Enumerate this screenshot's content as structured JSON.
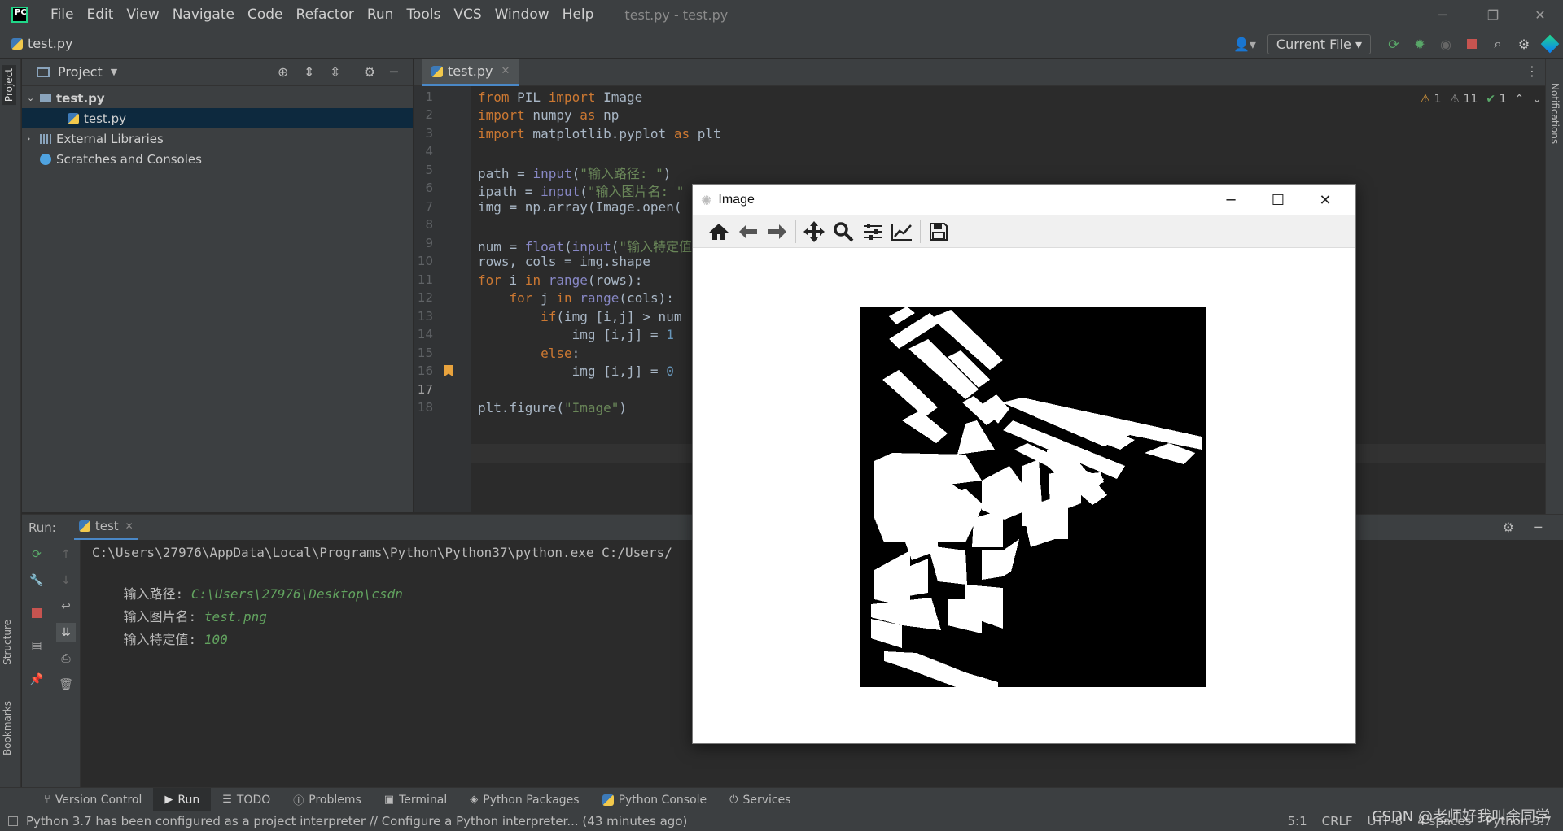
{
  "titlebar": {
    "logo": "PC",
    "menu": [
      "File",
      "Edit",
      "View",
      "Navigate",
      "Code",
      "Refactor",
      "Run",
      "Tools",
      "VCS",
      "Window",
      "Help"
    ],
    "window_title": "test.py - test.py",
    "controls": {
      "minimize": "─",
      "restore": "❐",
      "close": "✕"
    }
  },
  "navbar": {
    "breadcrumb": "test.py",
    "run_config": "Current File ▾",
    "icons": [
      "user-icon",
      "rerun-icon",
      "debug-icon",
      "coverage-icon",
      "stop-icon",
      "search-icon",
      "settings-icon",
      "jetbrains-icon"
    ]
  },
  "left_stripe": {
    "project": "Project",
    "structure": "Structure",
    "bookmarks": "Bookmarks"
  },
  "project": {
    "title": "Project",
    "tree": [
      {
        "label": "test.py",
        "bold": true
      },
      {
        "label": "test.py"
      },
      {
        "label": "External Libraries"
      },
      {
        "label": "Scratches and Consoles"
      }
    ]
  },
  "editor": {
    "tab": "test.py",
    "inspections": {
      "warnings": "1",
      "weak_warnings": "11",
      "ok": "1"
    },
    "line_numbers": [
      "1",
      "2",
      "3",
      "4",
      "5",
      "6",
      "7",
      "8",
      "9",
      "10",
      "11",
      "12",
      "13",
      "14",
      "15",
      "16",
      "17",
      "18"
    ],
    "lines": [
      "from PIL import Image",
      "import numpy as np",
      "import matplotlib.pyplot as plt",
      "",
      "path = input(\"输入路径: \")",
      "ipath = input(\"输入图片名: \"",
      "img = np.array(Image.open(",
      "",
      "num = float(input(\"输入特定值",
      "rows, cols = img.shape",
      "for i in range(rows):",
      "    for j in range(cols):",
      "        if(img [i,j] > num",
      "            img [i,j] = 1",
      "        else:",
      "            img [i,j] = 0",
      "",
      "plt.figure(\"Image\")"
    ]
  },
  "run": {
    "label": "Run:",
    "tab": "test",
    "command": "C:\\Users\\27976\\AppData\\Local\\Programs\\Python\\Python37\\python.exe C:/Users/",
    "prompts": [
      {
        "prompt": "输入路径: ",
        "value": "C:\\Users\\27976\\Desktop\\csdn"
      },
      {
        "prompt": "输入图片名: ",
        "value": "test.png"
      },
      {
        "prompt": "输入特定值: ",
        "value": "100"
      }
    ]
  },
  "tool_strip": [
    "Version Control",
    "Run",
    "TODO",
    "Problems",
    "Terminal",
    "Python Packages",
    "Python Console",
    "Services"
  ],
  "status": {
    "message": "Python 3.7 has been configured as a project interpreter // Configure a Python interpreter... (43 minutes ago)",
    "position": "5:1",
    "line_sep": "CRLF",
    "encoding": "UTF-8",
    "indent": "4 spaces",
    "interpreter": "Python 3.7"
  },
  "watermark": "CSDN @老师好我叫余同学",
  "right_stripe": {
    "notifications": "Notifications"
  },
  "mpl_window": {
    "title": "Image",
    "controls": {
      "minimize": "─",
      "maximize": "☐",
      "close": "✕"
    },
    "toolbar": [
      "home-icon",
      "back-icon",
      "forward-icon",
      "pan-icon",
      "zoom-icon",
      "configure-subplots-icon",
      "edit-axis-icon",
      "save-icon"
    ]
  },
  "colors": {
    "accent": "#4a88c7",
    "keyword": "#cc7832",
    "string": "#6a8759",
    "number": "#6897bb",
    "builtin": "#8888c6",
    "console_input": "#62a35f"
  }
}
